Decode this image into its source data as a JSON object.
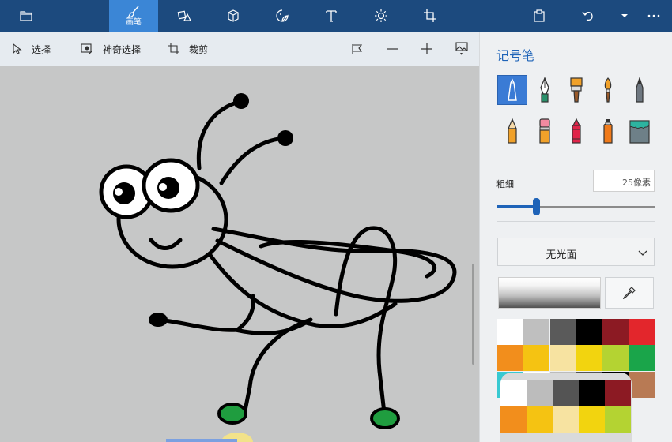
{
  "toolbar": {
    "active_label": "画笔",
    "items": [
      "folder-icon",
      "brush-icon",
      "shapes-2d-icon",
      "cube-icon",
      "sticker-icon",
      "text-icon",
      "effects-icon",
      "crop-icon",
      "paste-icon",
      "undo-icon",
      "more-dropdown-icon",
      "more-icon"
    ]
  },
  "subtoolbar": {
    "select_label": "选择",
    "magic_select_label": "神奇选择",
    "crop_label": "裁剪"
  },
  "panel": {
    "title": "记号笔",
    "brushes": [
      "marker",
      "calligraphy-pen",
      "oil-brush",
      "watercolor",
      "pixel-pen",
      "pencil",
      "eraser",
      "crayon",
      "spray-can",
      "fill"
    ],
    "thickness_label": "粗细",
    "thickness_value": "25像素",
    "thickness_fraction": 0.25,
    "finish_value": "无光面",
    "palette": [
      "#ffffff",
      "#bfbfbf",
      "#5a5a5a",
      "#000000",
      "#8c1a23",
      "#e3262c",
      "#f28e1c",
      "#f5c312",
      "#f7e3a1",
      "#f2d40f",
      "#b4d332",
      "#1aa54a",
      "#38c9d1",
      "#ffffff",
      "#bcbcbc",
      "#545454",
      "#000000",
      "#b87a54"
    ]
  },
  "colors": {
    "accent": "#3b86d6",
    "toolbar": "#1c4a7e",
    "canvas": "#c6c7c7"
  }
}
